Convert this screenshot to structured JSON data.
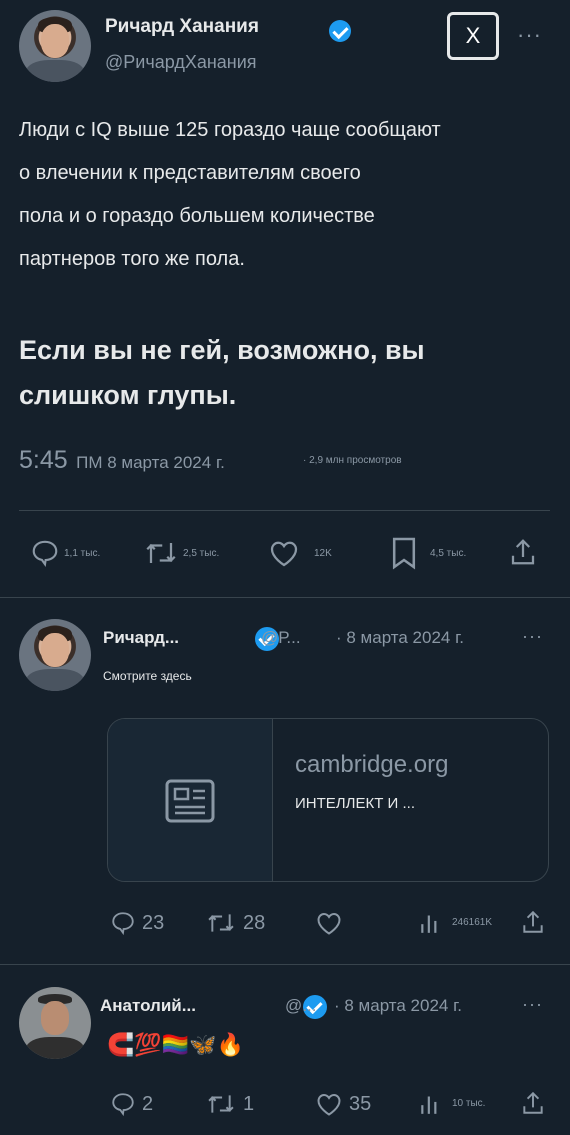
{
  "main_tweet": {
    "author_name": "Ричард Ханания",
    "author_handle": "@РичардХанания",
    "close_label": "X",
    "more_label": "···",
    "text_lines": [
      "Люди с IQ выше 125 гораздо чаще сообщают",
      "о влечении к представителям своего",
      "пола и о гораздо большем количестве",
      "партнеров того же пола."
    ],
    "big_lines": [
      "Если вы не гей, возможно, вы",
      "слишком глупы."
    ],
    "time": "5:45",
    "time_suffix": "ПМ 8 марта 2024 г.",
    "views": "· 2,9 млн просмотров",
    "actions": {
      "replies": "1,1 тыс.",
      "retweets": "2,5 тыс.",
      "likes": "12K",
      "bookmarks": "4,5 тыс."
    }
  },
  "reply1": {
    "author_name": "Ричард...",
    "author_handle": "@Р...",
    "date": "· 8 марта 2024 г.",
    "more_label": "···",
    "text": "Смотрите здесь",
    "card": {
      "domain": "cambridge.org",
      "title": "ИНТЕЛЛЕКТ И ..."
    },
    "actions": {
      "replies": "23",
      "retweets": "28",
      "views": "246161K"
    }
  },
  "reply2": {
    "author_name": "Анатолий...",
    "author_handle": "@...",
    "date": "· 8 марта 2024 г.",
    "more_label": "···",
    "emoji": "🧲💯🏳️‍🌈🦋🔥",
    "actions": {
      "replies": "2",
      "retweets": "1",
      "likes": "35",
      "views": "10 тыс."
    }
  },
  "colors": {
    "background": "#15202b",
    "accent": "#1d9bf0",
    "muted": "#8b98a5"
  }
}
